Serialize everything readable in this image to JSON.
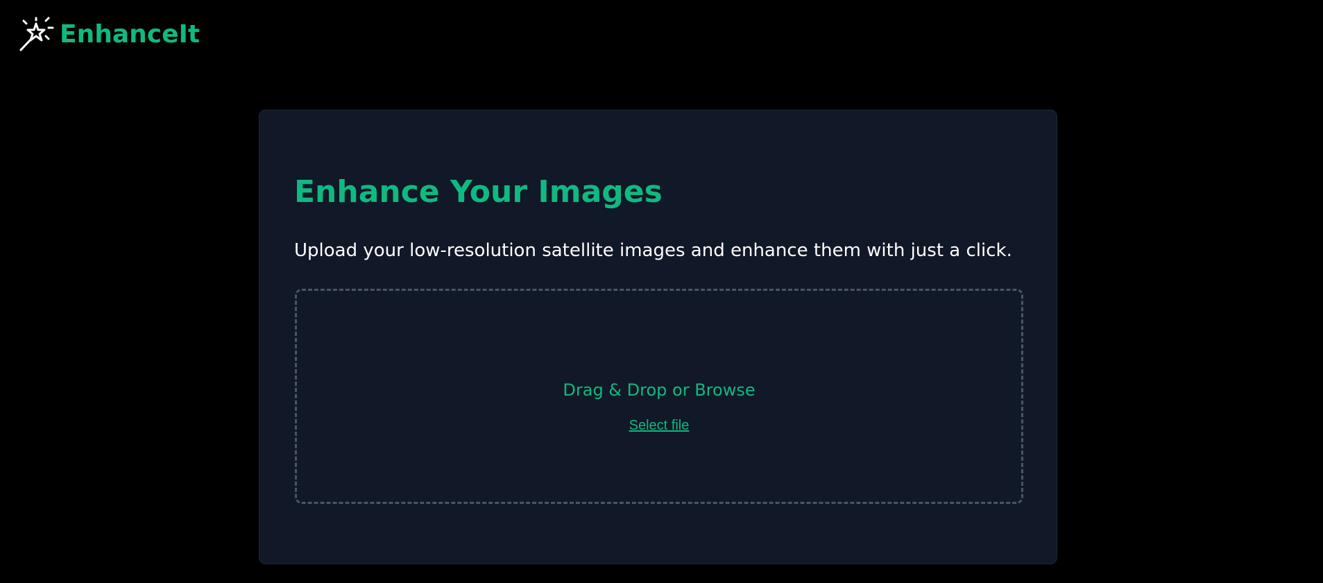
{
  "header": {
    "logo_icon": "magic-wand-icon",
    "brand": "EnhanceIt"
  },
  "main": {
    "title": "Enhance Your Images",
    "subtitle": "Upload your low-resolution satellite images and enhance them with just a click.",
    "dropzone": {
      "prompt": "Drag & Drop or Browse",
      "select_label": "Select file"
    }
  },
  "colors": {
    "accent": "#10b981",
    "background": "#000000",
    "card": "#111827",
    "dropzone_border": "#4b5563",
    "text": "#ffffff"
  }
}
